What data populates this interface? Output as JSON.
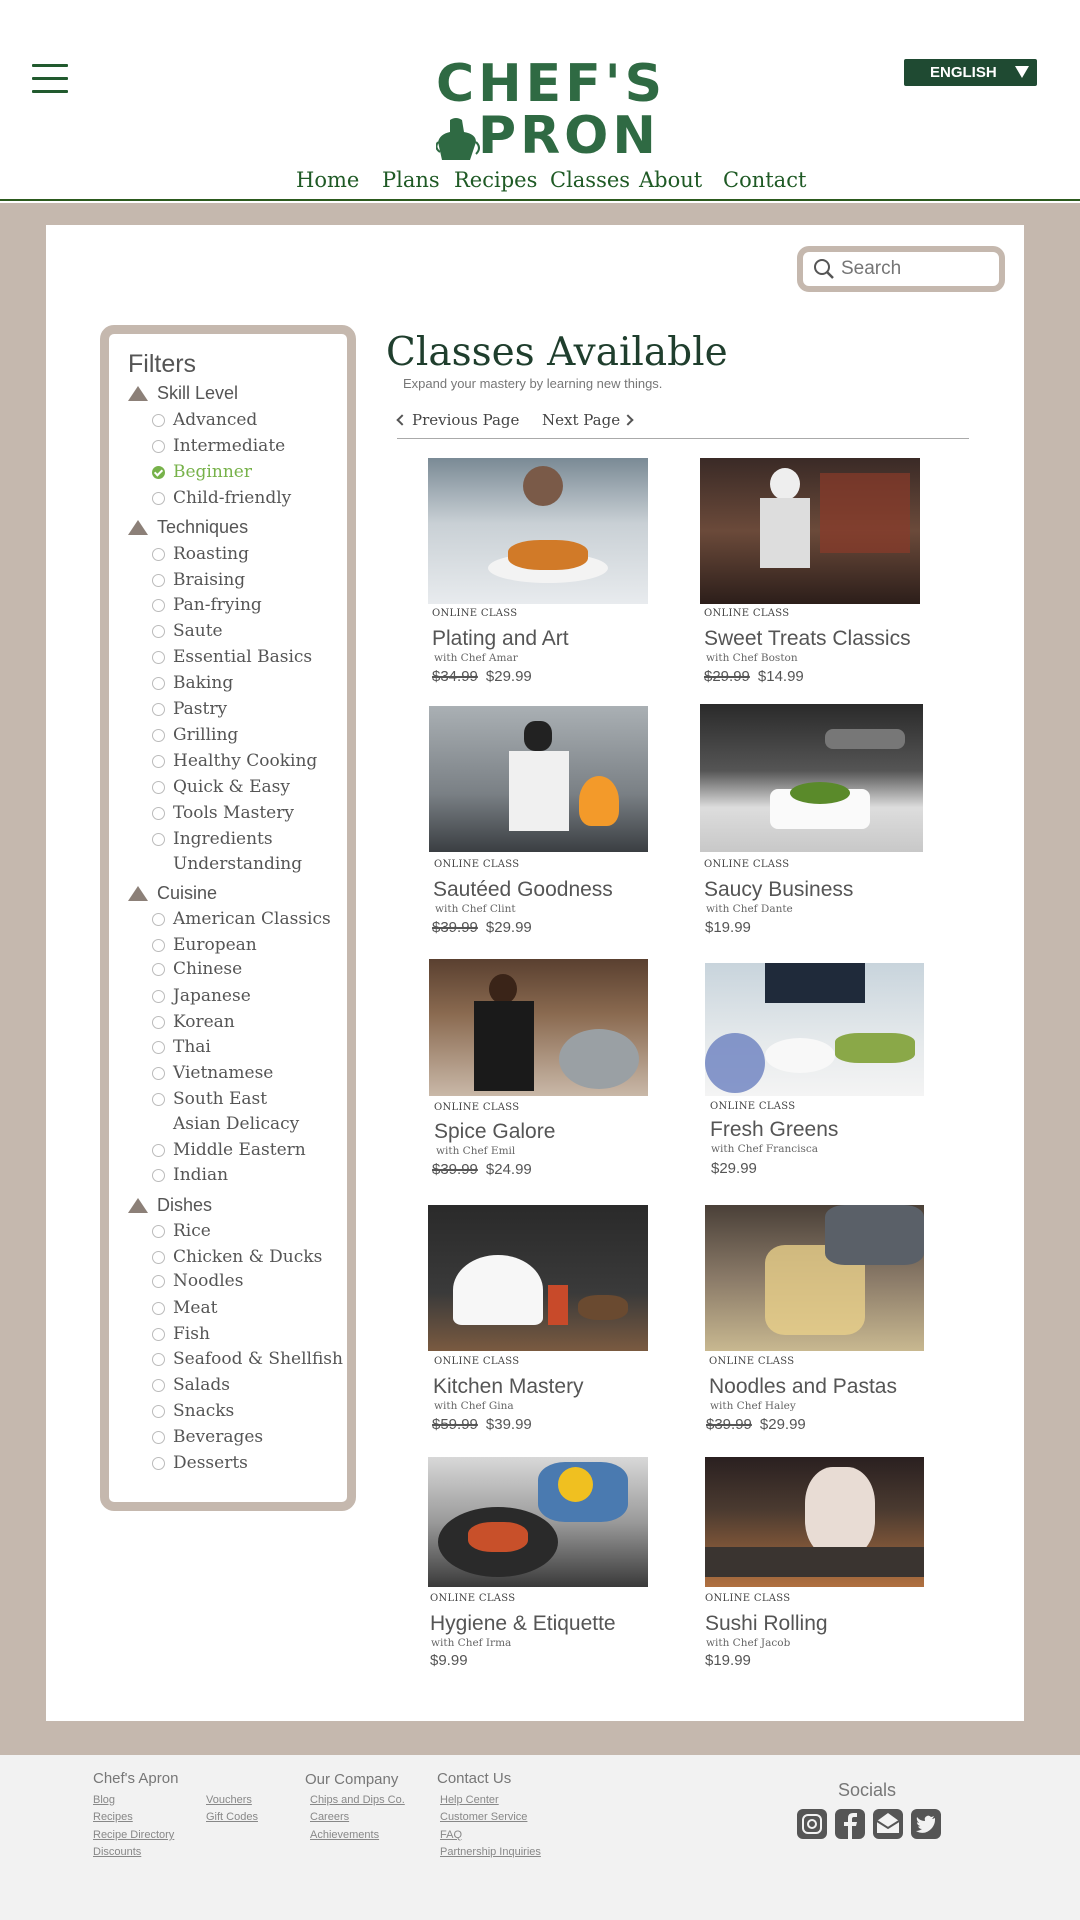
{
  "header": {
    "logo_line1": "CHEF'S",
    "logo_line2": "PRON",
    "language": "ENGLISH",
    "nav": [
      "Home",
      "Plans",
      "Recipes",
      "Classes",
      "About",
      "Contact"
    ]
  },
  "search": {
    "placeholder": "Search"
  },
  "filters": {
    "title": "Filters",
    "groups": [
      {
        "label": "Skill Level",
        "options": [
          "Advanced",
          "Intermediate",
          "Beginner",
          "Child-friendly"
        ],
        "checked": "Beginner"
      },
      {
        "label": "Techniques",
        "options": [
          "Roasting",
          "Braising",
          "Pan-frying",
          "Saute",
          "Essential Basics",
          "Baking",
          "Pastry",
          "Grilling",
          "Healthy Cooking",
          "Quick & Easy",
          "Tools Mastery",
          "Ingredients Understanding"
        ]
      },
      {
        "label": "Cuisine",
        "options": [
          "American Classics",
          "European",
          "Chinese",
          "Japanese",
          "Korean",
          "Thai",
          "Vietnamese",
          "South East Asian Delicacy",
          "Middle Eastern",
          "Indian"
        ]
      },
      {
        "label": "Dishes",
        "options": [
          "Rice",
          "Chicken & Ducks",
          "Noodles",
          "Meat",
          "Fish",
          "Seafood & Shellfish",
          "Salads",
          "Snacks",
          "Beverages",
          "Desserts"
        ]
      }
    ]
  },
  "main": {
    "title": "Classes Available",
    "subtitle": "Expand your mastery by learning new things.",
    "prev": "Previous Page",
    "next": "Next Page"
  },
  "products": [
    {
      "tag": "ONLINE CLASS",
      "name": "Plating and Art",
      "chef": "with Chef Amar",
      "old_price": "$34.99",
      "price": "$29.99"
    },
    {
      "tag": "ONLINE CLASS",
      "name": "Sweet Treats Classics",
      "chef": "with Chef Boston",
      "old_price": "$29.99",
      "price": "$14.99"
    },
    {
      "tag": "ONLINE CLASS",
      "name": "Sautéed Goodness",
      "chef": "with Chef Clint",
      "old_price": "$39.99",
      "price": "$29.99"
    },
    {
      "tag": "ONLINE CLASS",
      "name": "Saucy Business",
      "chef": "with Chef Dante",
      "old_price": "",
      "price": "$19.99"
    },
    {
      "tag": "ONLINE CLASS",
      "name": "Spice Galore",
      "chef": "with Chef Emil",
      "old_price": "$39.99",
      "price": "$24.99"
    },
    {
      "tag": "ONLINE CLASS",
      "name": "Fresh Greens",
      "chef": "with Chef Francisca",
      "old_price": "",
      "price": "$29.99"
    },
    {
      "tag": "ONLINE CLASS",
      "name": "Kitchen Mastery",
      "chef": "with Chef Gina",
      "old_price": "$59.99",
      "price": "$39.99"
    },
    {
      "tag": "ONLINE CLASS",
      "name": "Noodles and Pastas",
      "chef": "with Chef Haley",
      "old_price": "$39.99",
      "price": "$29.99"
    },
    {
      "tag": "ONLINE CLASS",
      "name": "Hygiene & Etiquette",
      "chef": "with Chef Irma",
      "old_price": "",
      "price": "$9.99"
    },
    {
      "tag": "ONLINE CLASS",
      "name": "Sushi Rolling",
      "chef": "with Chef Jacob",
      "old_price": "",
      "price": "$19.99"
    }
  ],
  "footer": {
    "col1_title": "Chef's Apron",
    "col1_links": [
      "Blog",
      "Recipes",
      "Recipe Directory",
      "Discounts"
    ],
    "col1b_links": [
      "Vouchers",
      "Gift Codes"
    ],
    "col2_title": "Our Company",
    "col2_links": [
      "Chips and Dips Co.",
      "Careers",
      "Achievements"
    ],
    "col3_title": "Contact Us",
    "col3_links": [
      "Help Center",
      "Customer Service",
      "FAQ",
      "Partnership Inquiries"
    ],
    "socials_title": "Socials",
    "social_icons": [
      "instagram-icon",
      "facebook-icon",
      "email-icon",
      "twitter-icon"
    ]
  },
  "colors": {
    "brand_green": "#2f6a43",
    "nav_green": "#1f5a25",
    "band": "#c5b8ae",
    "checked_green": "#77b24a"
  }
}
